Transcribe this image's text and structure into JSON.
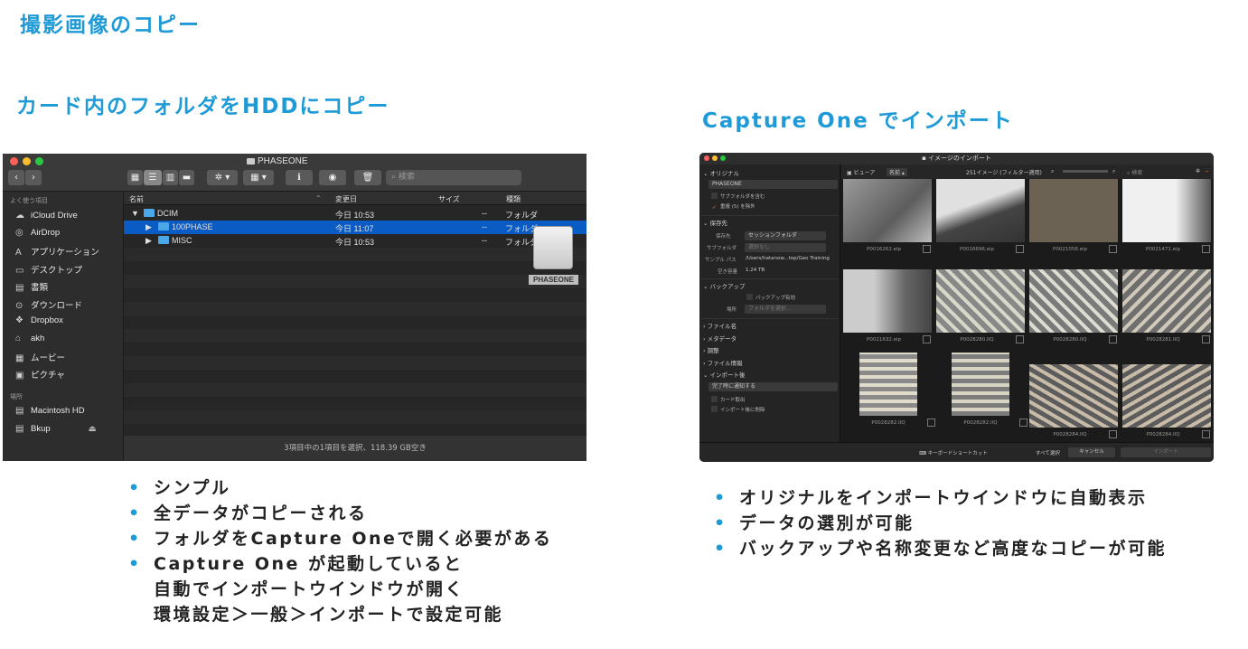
{
  "headings": {
    "main": "撮影画像のコピー",
    "left": "カード内のフォルダをHDDにコピー",
    "right": "Capture One でインポート"
  },
  "finder": {
    "title": "PHASEONE",
    "search_placeholder": "検索",
    "sidebar_sections": [
      "よく使う項目",
      "場所"
    ],
    "sidebar_items": [
      {
        "label": "iCloud Drive",
        "icon": "cloud-icon",
        "glyph": "☁"
      },
      {
        "label": "AirDrop",
        "icon": "airdrop-icon",
        "glyph": "◎"
      },
      {
        "label": "アプリケーション",
        "icon": "applications-icon",
        "glyph": "A"
      },
      {
        "label": "デスクトップ",
        "icon": "desktop-icon",
        "glyph": "▭"
      },
      {
        "label": "書類",
        "icon": "documents-icon",
        "glyph": "▤"
      },
      {
        "label": "ダウンロード",
        "icon": "download-icon",
        "glyph": "⊙"
      },
      {
        "label": "Dropbox",
        "icon": "dropbox-icon",
        "glyph": "❖"
      },
      {
        "label": "akh",
        "icon": "home-icon",
        "glyph": "⌂"
      },
      {
        "label": "ムービー",
        "icon": "movies-icon",
        "glyph": "▦"
      },
      {
        "label": "ピクチャ",
        "icon": "pictures-icon",
        "glyph": "▣"
      },
      {
        "label": "Macintosh HD",
        "icon": "hard-disk-icon",
        "glyph": "▤"
      },
      {
        "label": "Bkup",
        "icon": "hard-disk-icon",
        "glyph": "▤"
      }
    ],
    "columns": [
      "名前",
      "変更日",
      "サイズ",
      "種類"
    ],
    "rows": [
      {
        "name": "DCIM",
        "date": "今日 10:53",
        "size": "--",
        "kind": "フォルダ"
      },
      {
        "name": "100PHASE",
        "date": "今日 11:07",
        "size": "--",
        "kind": "フォルダ"
      },
      {
        "name": "MISC",
        "date": "今日 10:53",
        "size": "--",
        "kind": "フォルダ"
      }
    ],
    "status": "3項目中の1項目を選択、118.39 GB空き",
    "drive_label": "PHASEONE"
  },
  "captureone": {
    "title": "イメージのインポート",
    "sections": {
      "original": "オリジナル",
      "source": "PHASEONE",
      "include_sub": "サブフォルダを含む",
      "exclude_dup": "重複 (5) を除外",
      "destination": "保存先",
      "dest_label": "保存先",
      "dest_value": "セッションフォルダ",
      "subfolder_label": "サブフォルダ",
      "subfolder_value": "選択なし",
      "sample_path_label": "サンプル パス",
      "sample_path_value": "/Users/hatanow...top/Geo Training",
      "free_label": "空き容量",
      "free_value": "1.24 TB",
      "backup": "バックアップ",
      "backup_enable": "バックアップ有効",
      "location_label": "場所",
      "location_value": "フォルダを選択...",
      "filename": "ファイル名",
      "metadata": "メタデータ",
      "adjust": "調整",
      "fileinfo": "ファイル情報",
      "after_import": "インポート後",
      "notify": "完了時に通知する",
      "eject": "カード取出",
      "delete_after": "インポート後に削除"
    },
    "toolbar": {
      "view": "ビューア",
      "sort": "名前",
      "count": "251イメージ (フィルター適用)",
      "search": "検索"
    },
    "thumbs": [
      "P0016262.eip",
      "P0016696.eip",
      "P0021058.eip",
      "P0021471.eip",
      "P0021632.eip",
      "P0028280.IIQ",
      "P0028280.IIQ",
      "P0028281.IIQ",
      "P0028282.IIQ",
      "P0028282.IIQ",
      "P0028284.IIQ",
      "P0028284.IIQ"
    ],
    "bottom": {
      "shortcut": "キーボードショートカット",
      "select_all": "すべて選択",
      "cancel": "キャンセル",
      "import": "インポート"
    }
  },
  "bullets_left": [
    "シンプル",
    "全データがコピーされる",
    "フォルダをCapture Oneで開く必要がある",
    "Capture One が起動していると",
    "自動でインポートウインドウが開く",
    "環境設定＞一般＞インポートで設定可能"
  ],
  "bullets_right": [
    "オリジナルをインポートウインドウに自動表示",
    "データの選別が可能",
    "バックアップや名称変更など高度なコピーが可能"
  ],
  "colors": {
    "accent": "#1e9ad6",
    "selection": "#0a5bc4",
    "orange": "#f07a1a"
  }
}
